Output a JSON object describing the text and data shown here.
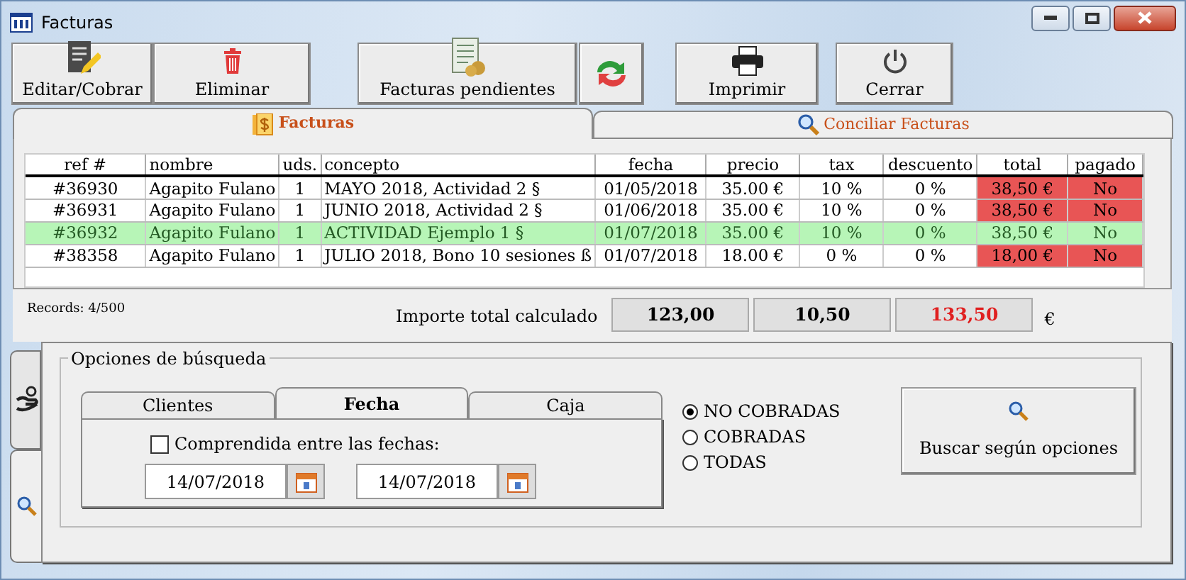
{
  "window": {
    "title": "Facturas"
  },
  "toolbar": [
    {
      "kind": "labeled",
      "label": "Editar/Cobrar"
    },
    {
      "kind": "labeled",
      "label": "Eliminar"
    },
    {
      "kind": "labeled",
      "label": "Facturas pendientes"
    },
    {
      "kind": "icon"
    },
    {
      "kind": "labeled",
      "label": "Imprimir"
    },
    {
      "kind": "labeled",
      "label": "Cerrar"
    }
  ],
  "tabs": [
    {
      "label": "Facturas",
      "selected": true
    },
    {
      "label": "Conciliar Facturas",
      "selected": false
    }
  ],
  "table": {
    "columns": [
      "ref #",
      "nombre",
      "uds.",
      "concepto",
      "fecha",
      "precio",
      "tax",
      "descuento",
      "total",
      "pagado"
    ],
    "rows": [
      {
        "cells": [
          "#36930",
          "Agapito Fulano",
          "1",
          "MAYO 2018, Actividad 2 §",
          "01/05/2018",
          "35.00 €",
          "10 %",
          "0 %",
          "38,50 €",
          "No"
        ],
        "selected": false,
        "flagged": true
      },
      {
        "cells": [
          "#36931",
          "Agapito Fulano",
          "1",
          "JUNIO 2018, Actividad 2 §",
          "01/06/2018",
          "35.00 €",
          "10 %",
          "0 %",
          "38,50 €",
          "No"
        ],
        "selected": false,
        "flagged": true
      },
      {
        "cells": [
          "#36932",
          "Agapito Fulano",
          "1",
          "ACTIVIDAD Ejemplo 1 §",
          "01/07/2018",
          "35.00 €",
          "10 %",
          "0 %",
          "38,50 €",
          "No"
        ],
        "selected": true,
        "flagged": true
      },
      {
        "cells": [
          "#38358",
          "Agapito Fulano",
          "1",
          "JULIO 2018, Bono 10 sesiones ß",
          "01/07/2018",
          "18.00 €",
          "0 %",
          "0 %",
          "18,00 €",
          "No"
        ],
        "selected": false,
        "flagged": true
      }
    ]
  },
  "records": "Records: 4/500",
  "totals": {
    "label": "Importe total calculado",
    "values": [
      {
        "text": "123,00",
        "color": "#000000"
      },
      {
        "text": "10,50",
        "color": "#000000"
      },
      {
        "text": "133,50",
        "color": "#e02020"
      }
    ],
    "currency": "€"
  },
  "side_tabs": [
    {
      "selected": false
    },
    {
      "selected": true
    }
  ],
  "search": {
    "title": "Opciones de búsqueda",
    "tabs": [
      {
        "label": "Clientes",
        "selected": false
      },
      {
        "label": "Fecha",
        "selected": true
      },
      {
        "label": "Caja",
        "selected": false
      }
    ],
    "checkbox": {
      "label": "Comprendida entre las fechas:",
      "checked": false
    },
    "dates": [
      "14/07/2018",
      "14/07/2018"
    ],
    "radios": [
      {
        "label": "NO COBRADAS",
        "selected": true
      },
      {
        "label": "COBRADAS",
        "selected": false
      },
      {
        "label": "TODAS",
        "selected": false
      }
    ],
    "button": "Buscar según opciones"
  }
}
